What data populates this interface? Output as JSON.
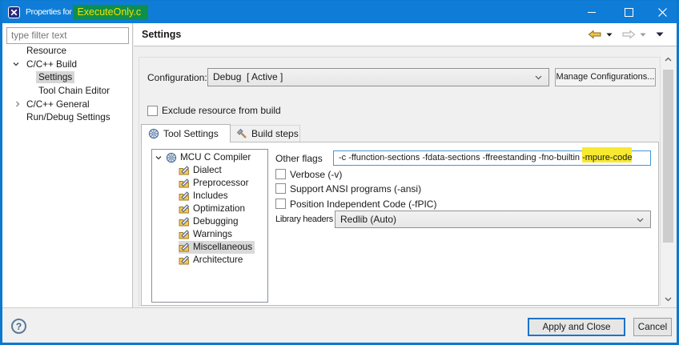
{
  "window": {
    "title_prefix": "Properties for",
    "title_highlight": "ExecuteOnly.c"
  },
  "sidebar": {
    "filter_placeholder": "type filter text",
    "tree": [
      {
        "label": "Resource"
      },
      {
        "label": "C/C++ Build"
      },
      {
        "label": "Settings"
      },
      {
        "label": "Tool Chain Editor"
      },
      {
        "label": "C/C++ General"
      },
      {
        "label": "Run/Debug Settings"
      }
    ]
  },
  "header": {
    "title": "Settings"
  },
  "config": {
    "label": "Configuration:",
    "value": "Debug  [ Active ]",
    "manage_button": "Manage Configurations..."
  },
  "exclude_checkbox": {
    "label": "Exclude resource from build",
    "checked": false
  },
  "tabs": [
    {
      "label": "Tool Settings"
    },
    {
      "label": "Build steps"
    }
  ],
  "tool_tree": {
    "root": "MCU C Compiler",
    "children": [
      "Dialect",
      "Preprocessor",
      "Includes",
      "Optimization",
      "Debugging",
      "Warnings",
      "Miscellaneous",
      "Architecture"
    ],
    "selected": "Miscellaneous"
  },
  "form": {
    "other_flags_label": "Other flags",
    "other_flags_value": "-c -ffunction-sections -fdata-sections -ffreestanding -fno-builtin ",
    "other_flags_highlight": "-mpure-code",
    "checkboxes": [
      "Verbose (-v)",
      "Support ANSI programs (-ansi)",
      "Position Independent Code (-fPIC)"
    ],
    "library_headers_label": "Library headers",
    "library_headers_value": "Redlib (Auto)"
  },
  "footer": {
    "help": "?",
    "apply_button": "Apply and Close",
    "cancel_button": "Cancel"
  },
  "colors": {
    "titlebar": "#0f7dd7",
    "highlight_green": "#0e8f4d",
    "highlight_yellow": "#f7e930",
    "accent_blue": "#0b79d0"
  }
}
